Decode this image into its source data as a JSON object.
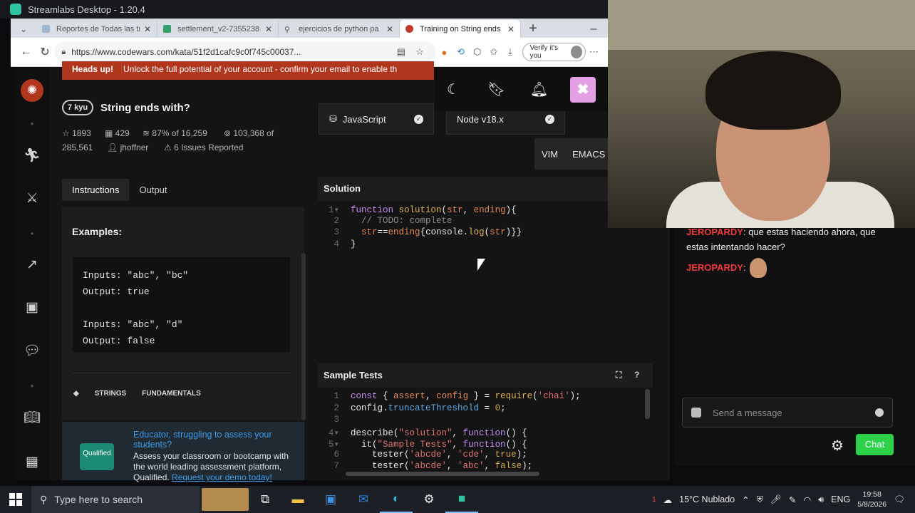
{
  "window": {
    "title": "Streamlabs Desktop - 1.20.4"
  },
  "browser": {
    "tabs": [
      {
        "label": "Reportes de Todas las tr",
        "active": false
      },
      {
        "label": "settlement_v2-7355238",
        "active": false
      },
      {
        "label": "ejercicios de python pa",
        "active": false
      },
      {
        "label": "Training on String ends",
        "active": true
      }
    ],
    "url": "https://www.codewars.com/kata/51f2d1cafc9c0f745c00037...",
    "profile_label": "Verify it's you"
  },
  "codewars": {
    "banner_bold": "Heads up!",
    "banner_text": "Unlock the full potential of your account - confirm your email to enable th",
    "kyu": "7 kyu",
    "kata_title": "String ends with?",
    "stats": {
      "stars": "1893",
      "collections": "429",
      "satisfaction": "87% of 16,259",
      "completed_line1": "103,368 of",
      "completed_line2": "285,561",
      "author": "jhoffner",
      "issues": "6 Issues Reported"
    },
    "left_tabs": [
      "Instructions",
      "Output"
    ],
    "examples_title": "Examples:",
    "example_lines": [
      "Inputs: \"abc\", \"bc\"",
      "Output: true",
      "",
      "Inputs: \"abc\", \"d\"",
      "Output: false"
    ],
    "tags": [
      "STRINGS",
      "FUNDAMENTALS"
    ],
    "promo": {
      "logo": "Qualified",
      "title": "Educator, struggling to assess your students?",
      "body": "Assess your classroom or bootcamp with the world leading assessment platform, Qualified.",
      "link": "Request your demo today!"
    },
    "language": "JavaScript",
    "runtime": "Node v18.x",
    "keymaps": [
      "VIM",
      "EMACS"
    ],
    "solution_header": "Solution",
    "sample_tests_header": "Sample Tests"
  },
  "chat": {
    "messages": [
      {
        "user": "JEROPARDY",
        "text": "que estas haciendo ahora, que estas intentando hacer?"
      },
      {
        "user": "JEROPARDY",
        "text": ""
      }
    ],
    "input_placeholder": "Send a message",
    "send_label": "Chat"
  },
  "taskbar": {
    "search_placeholder": "Type here to search",
    "weather": "15°C  Nublado",
    "lang": "ENG",
    "time": "19:58",
    "date": "5/8/2026",
    "weather_badge": "1"
  }
}
